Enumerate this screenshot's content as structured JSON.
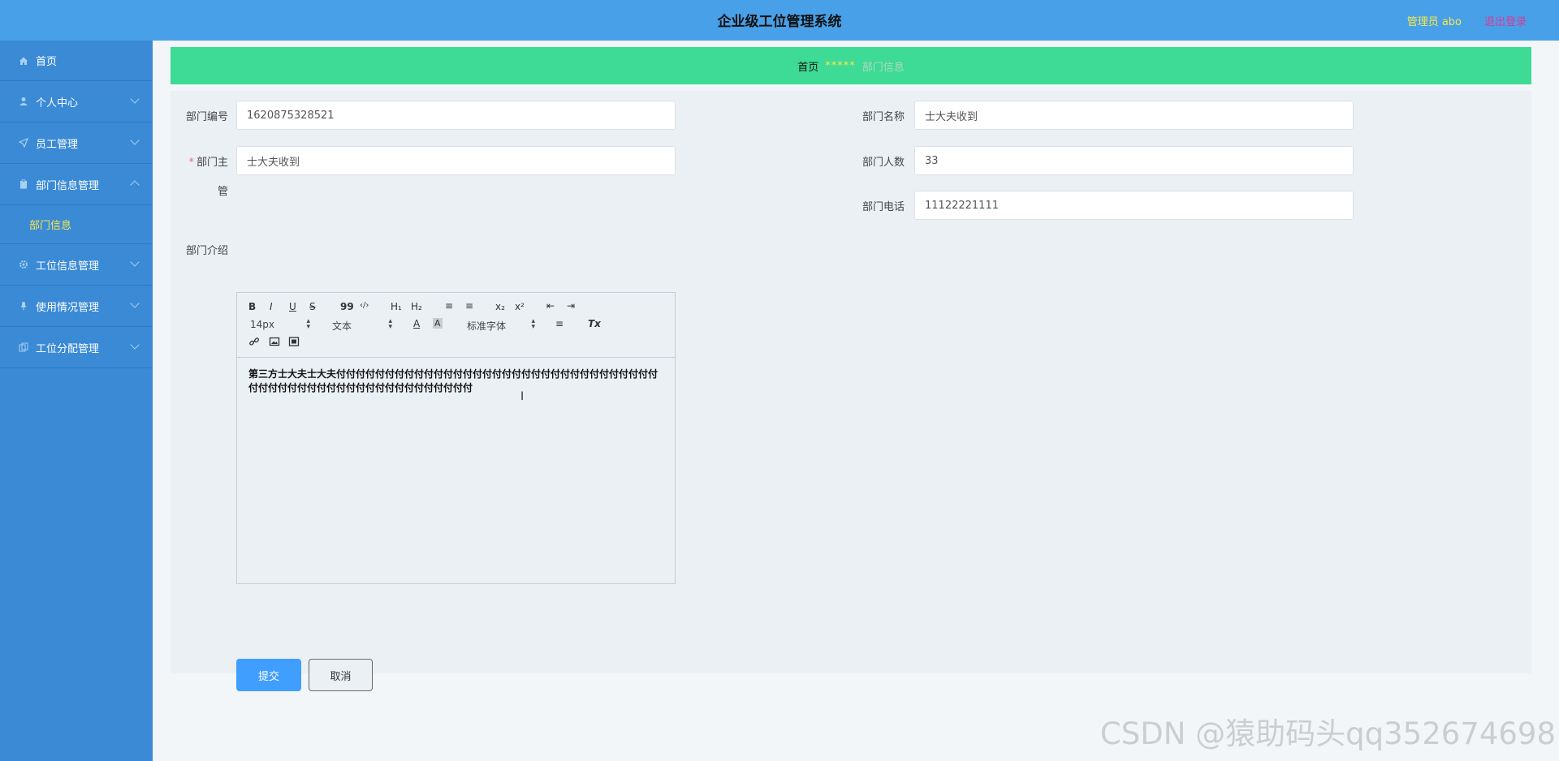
{
  "header": {
    "title": "企业级工位管理系统",
    "user": "管理员 abo",
    "logout": "退出登录"
  },
  "sidebar": {
    "items": [
      {
        "label": "首页",
        "icon": "home-icon"
      },
      {
        "label": "个人中心",
        "icon": "user-icon"
      },
      {
        "label": "员工管理",
        "icon": "send-icon"
      },
      {
        "label": "部门信息管理",
        "icon": "clipboard-icon",
        "expanded": true
      },
      {
        "label": "部门信息",
        "sub": true
      },
      {
        "label": "工位信息管理",
        "icon": "gear-icon"
      },
      {
        "label": "使用情况管理",
        "icon": "mic-icon"
      },
      {
        "label": "工位分配管理",
        "icon": "copy-icon"
      }
    ]
  },
  "breadcrumb": {
    "home": "首页",
    "separator": "*****",
    "current": "部门信息"
  },
  "form": {
    "dept_no_label": "部门编号",
    "dept_no_value": "1620875328521",
    "dept_name_label": "部门名称",
    "dept_name_value": "士大夫收到",
    "manager_label_1": "部门主",
    "manager_label_2": "管",
    "manager_value": "士大夫收到",
    "headcount_label": "部门人数",
    "headcount_value": "33",
    "phone_label": "部门电话",
    "phone_value": "11122221111",
    "intro_label": "部门介绍"
  },
  "editor": {
    "toolbar": {
      "bold": "B",
      "italic": "I",
      "underline": "U",
      "strike": "S",
      "quote": "99",
      "code": "‹/›",
      "h1": "H₁",
      "h2": "H₂",
      "ordered": "≡",
      "bullet": "≡",
      "sub": "x₂",
      "sup": "x²",
      "outdent": "⇤",
      "indent": "⇥",
      "size": "14px",
      "header": "文本",
      "color": "A",
      "bg": "A",
      "font": "标准字体",
      "align": "≡",
      "clean": "Tx",
      "link": "🔗",
      "image": "▣",
      "video": "▤"
    },
    "content": "第三方士大夫士大夫付付付付付付付付付付付付付付付付付付付付付付付付付付付付付付付付付付付付付付付付付付付付付付付付付付付付付付付付"
  },
  "buttons": {
    "submit": "提交",
    "cancel": "取消"
  },
  "watermark": "CSDN @猿助码头qq352674698",
  "colors": {
    "header": "#48a0e8",
    "sidebar": "#3a8ad6",
    "breadcrumb_bar": "#3ddb95",
    "accent": "#f5e94a",
    "primary_button": "#409eff"
  }
}
